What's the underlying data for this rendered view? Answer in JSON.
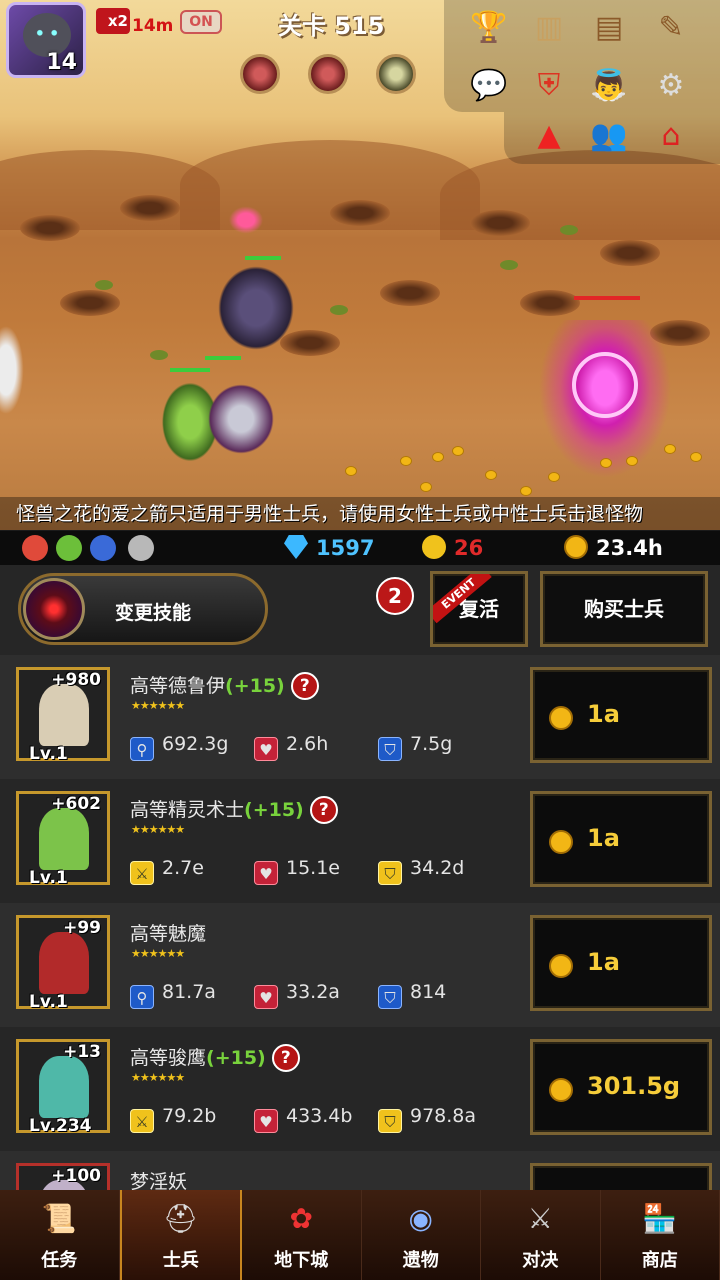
{
  "hud": {
    "player_level": "14",
    "speed_label": "x2",
    "timer": "14m",
    "auto_label": "ON",
    "stage_title": "关卡 515"
  },
  "buffs": [
    {
      "icon": "flower-debuff-icon"
    },
    {
      "icon": "flower-debuff-icon"
    },
    {
      "icon": "rock-buff-icon"
    }
  ],
  "top_menu": [
    {
      "icon": "trophy-icon"
    },
    {
      "icon": "ranking-podium-icon"
    },
    {
      "icon": "quest-book-icon"
    },
    {
      "icon": "edit-book-icon"
    },
    {
      "icon": "chat-icon"
    },
    {
      "icon": "guild-shield-icon"
    },
    {
      "icon": "angel-icon"
    },
    {
      "icon": "settings-gear-icon"
    },
    {
      "icon": "warning-triangle-icon"
    },
    {
      "icon": "friends-icon"
    },
    {
      "icon": "house-icon"
    }
  ],
  "ticker": "怪兽之花的爱之箭只适用于男性士兵，请使用女性士兵或中性士兵击退怪物",
  "resources": {
    "gems": "1597",
    "medals": "26",
    "gold_rate": "23.4h",
    "colors": {
      "gems": "#4fc3ff",
      "medals": "#e02a2a",
      "gold": "#ffffff"
    }
  },
  "actions": {
    "skill_label": "变更技能",
    "notify_count": "2",
    "revive_label": "复活",
    "event_tag": "EVENT",
    "buy_label": "购买士兵"
  },
  "soldiers": [
    {
      "name": "高等德鲁伊",
      "bonus": "(+15)",
      "has_info": true,
      "plus": "+980",
      "level": "Lv.1",
      "stars": "★★★★★★",
      "stat1_icon": "staff-icon",
      "stat1": "692.3g",
      "stat2": "2.6h",
      "stat3_icon": "blue-shield-icon",
      "stat3": "7.5g",
      "price": "1a",
      "portrait_color": "#d9cdb4"
    },
    {
      "name": "高等精灵术士",
      "bonus": "(+15)",
      "has_info": true,
      "plus": "+602",
      "level": "Lv.1",
      "stars": "★★★★★★",
      "stat1_icon": "sword-icon",
      "stat1": "2.7e",
      "stat2": "15.1e",
      "stat3_icon": "gold-shield-icon",
      "stat3": "34.2d",
      "price": "1a",
      "portrait_color": "#7cc34a"
    },
    {
      "name": "高等魅魔",
      "bonus": "",
      "has_info": false,
      "plus": "+99",
      "level": "Lv.1",
      "stars": "★★★★★★",
      "stat1_icon": "staff-icon",
      "stat1": "81.7a",
      "stat2": "33.2a",
      "stat3_icon": "blue-shield-icon",
      "stat3": "814",
      "price": "1a",
      "portrait_color": "#b22a2a"
    },
    {
      "name": "高等骏鹰",
      "bonus": "(+15)",
      "has_info": true,
      "plus": "+13",
      "level": "Lv.234",
      "stars": "★★★★★★",
      "stat1_icon": "sword-icon",
      "stat1": "79.2b",
      "stat2": "433.4b",
      "stat3_icon": "gold-shield-icon",
      "stat3": "978.8a",
      "price": "301.5g",
      "portrait_color": "#4fb8a8"
    },
    {
      "name": "梦淫妖",
      "plus": "+100"
    }
  ],
  "nav": [
    {
      "label": "任务",
      "icon": "scroll-icon"
    },
    {
      "label": "士兵",
      "icon": "helmet-icon"
    },
    {
      "label": "地下城",
      "icon": "monster-flower-icon"
    },
    {
      "label": "遗物",
      "icon": "relic-orb-icon"
    },
    {
      "label": "对决",
      "icon": "crossed-swords-icon"
    },
    {
      "label": "商店",
      "icon": "shop-icon"
    }
  ]
}
